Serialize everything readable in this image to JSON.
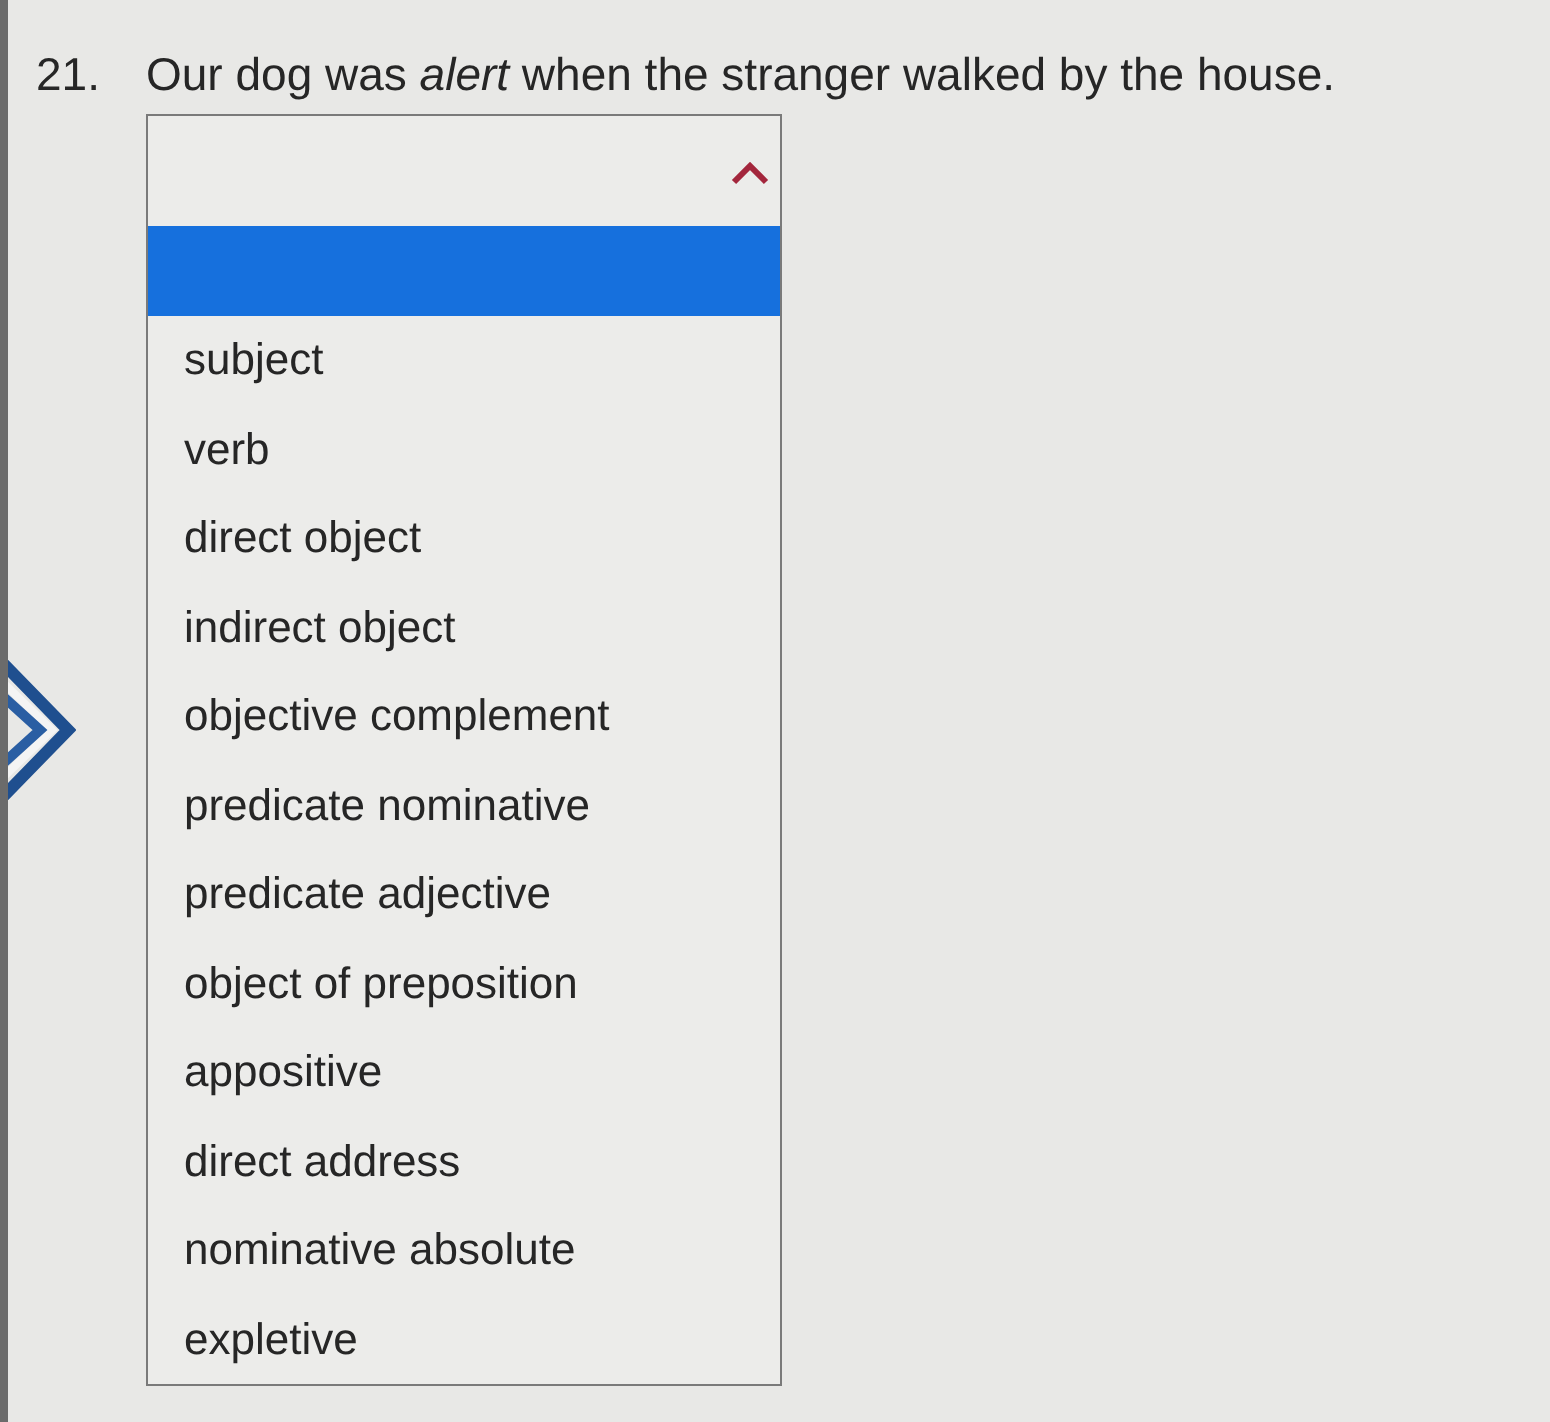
{
  "question": {
    "number": "21.",
    "text": "Our dog was *alert* when the stranger walked by the house."
  },
  "dropdown": {
    "expanded": true,
    "options": [
      {
        "selected": true
      },
      {
        "label": "subject",
        "selected": false
      },
      {
        "label": "verb",
        "selected": false
      },
      {
        "label": "direct object",
        "selected": false
      },
      {
        "label": "indirect object",
        "selected": false
      },
      {
        "label": "objective complement",
        "selected": false
      },
      {
        "label": "predicate nominative",
        "selected": false
      },
      {
        "label": "predicate adjective",
        "selected": false
      },
      {
        "label": "object of preposition",
        "selected": false
      },
      {
        "label": "appositive",
        "selected": false
      },
      {
        "label": "direct address",
        "selected": false
      },
      {
        "label": "nominative absolute",
        "selected": false
      },
      {
        "label": "expletive",
        "selected": false
      }
    ]
  }
}
